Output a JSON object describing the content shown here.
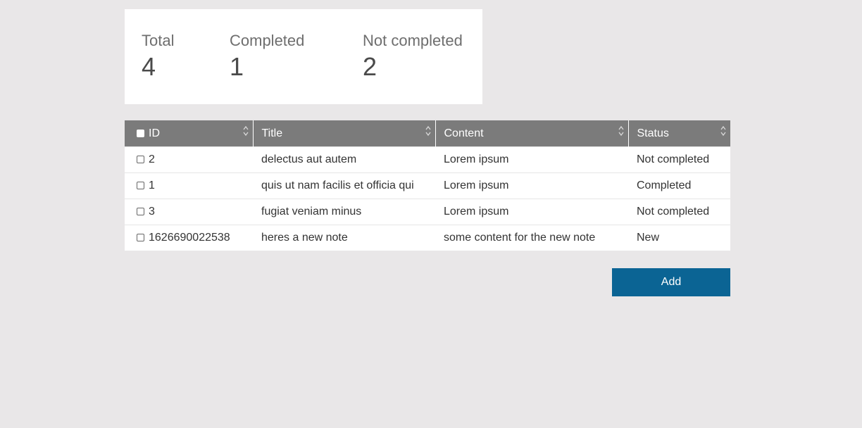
{
  "summary": {
    "total_label": "Total",
    "total_value": "4",
    "completed_label": "Completed",
    "completed_value": "1",
    "not_completed_label": "Not completed",
    "not_completed_value": "2"
  },
  "table": {
    "columns": [
      "ID",
      "Title",
      "Content",
      "Status"
    ],
    "rows": [
      {
        "id": "2",
        "title": "delectus aut autem",
        "content": "Lorem ipsum",
        "status": "Not completed"
      },
      {
        "id": "1",
        "title": "quis ut nam facilis et officia qui",
        "content": "Lorem ipsum",
        "status": "Completed"
      },
      {
        "id": "3",
        "title": "fugiat veniam minus",
        "content": "Lorem ipsum",
        "status": "Not completed"
      },
      {
        "id": "1626690022538",
        "title": "heres a new note",
        "content": "some content for the new note",
        "status": "New"
      }
    ]
  },
  "actions": {
    "add_label": "Add"
  },
  "colors": {
    "background": "#e9e7e8",
    "header": "#7b7b7b",
    "primary_button": "#0b6494"
  }
}
